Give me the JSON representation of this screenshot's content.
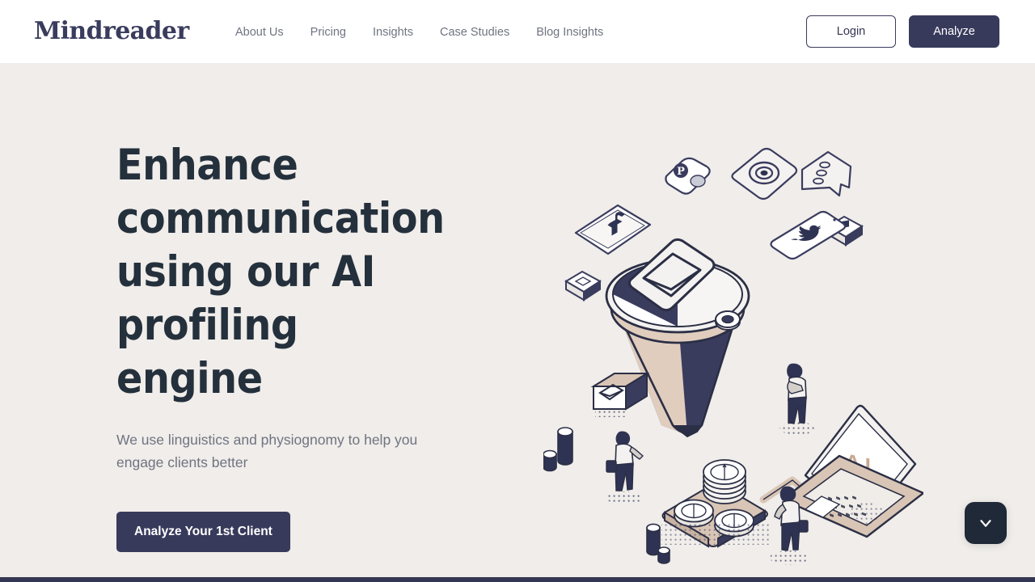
{
  "brand": {
    "name": "Mindreader"
  },
  "nav": {
    "items": [
      {
        "label": "About Us"
      },
      {
        "label": "Pricing"
      },
      {
        "label": "Insights"
      },
      {
        "label": "Case Studies"
      },
      {
        "label": "Blog Insights"
      }
    ]
  },
  "header": {
    "login_label": "Login",
    "analyze_label": "Analyze"
  },
  "hero": {
    "title": "Enhance communication using our AI profiling engine",
    "subtitle": "We use linguistics and physiognomy to help you engage clients better",
    "cta_label": "Analyze Your 1st Client",
    "illustration": {
      "name": "ai-funnel-social-media-isometric-illustration",
      "laptop_screen_text": "AI",
      "elements": [
        "facebook-tablet-icon",
        "pinterest-badge-icon",
        "instagram-camera-icon",
        "twitter-phone-icon",
        "envelope-icon",
        "chat-list-icon",
        "book-icon",
        "funnel",
        "coin-stack",
        "laptop-ai",
        "people-figures",
        "cylinders"
      ]
    }
  },
  "scroll": {
    "label": "chevron-down"
  },
  "colors": {
    "navy": "#383a5c",
    "dark_slate": "#24303c",
    "hero_bg": "#f0edea",
    "header_bg": "#ffffff",
    "muted_text": "#6f7480",
    "tan": "#d9c5b5",
    "scroll_btn": "#1f2937"
  }
}
